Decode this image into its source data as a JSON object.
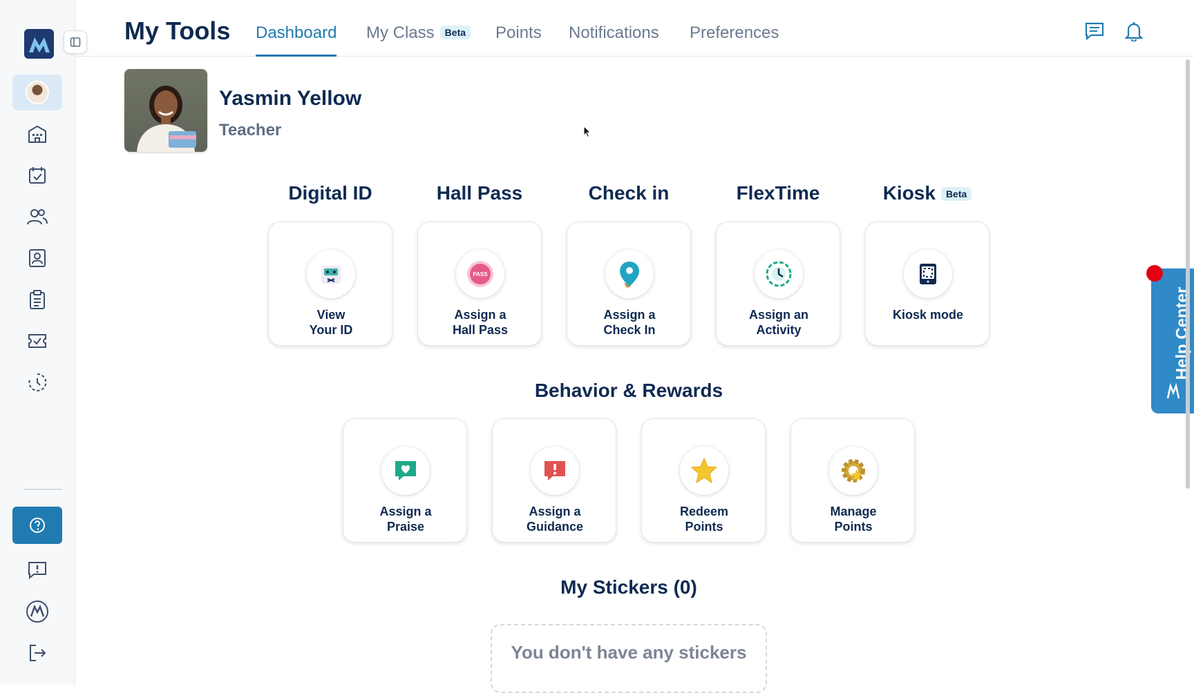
{
  "header": {
    "title": "My Tools",
    "tabs": [
      {
        "label": "Dashboard",
        "active": true
      },
      {
        "label": "My Class",
        "badge": "Beta"
      },
      {
        "label": "Points"
      },
      {
        "label": "Notifications"
      },
      {
        "label": "Preferences"
      }
    ]
  },
  "profile": {
    "name": "Yasmin Yellow",
    "role": "Teacher"
  },
  "tools": {
    "digital_id": {
      "heading": "Digital ID",
      "label": "View Your ID"
    },
    "hall_pass": {
      "heading": "Hall Pass",
      "label": "Assign a Hall Pass",
      "icon_text": "PASS"
    },
    "check_in": {
      "heading": "Check in",
      "label": "Assign a Check In"
    },
    "flextime": {
      "heading": "FlexTime",
      "label": "Assign an Activity"
    },
    "kiosk": {
      "heading": "Kiosk",
      "badge": "Beta",
      "label": "Kiosk mode"
    }
  },
  "behavior": {
    "heading": "Behavior & Rewards",
    "items": [
      {
        "label": "Assign a Praise"
      },
      {
        "label": "Assign a Guidance"
      },
      {
        "label": "Redeem Points"
      },
      {
        "label": "Manage Points"
      }
    ]
  },
  "stickers": {
    "heading": "My Stickers (0)",
    "empty_text": "You don't have any stickers"
  },
  "help_center": {
    "label": "Help Center"
  },
  "colors": {
    "accent": "#1f7bb0",
    "navy": "#0f2a52",
    "help_tab": "#2f8ac7",
    "notification_dot": "#e30012"
  }
}
